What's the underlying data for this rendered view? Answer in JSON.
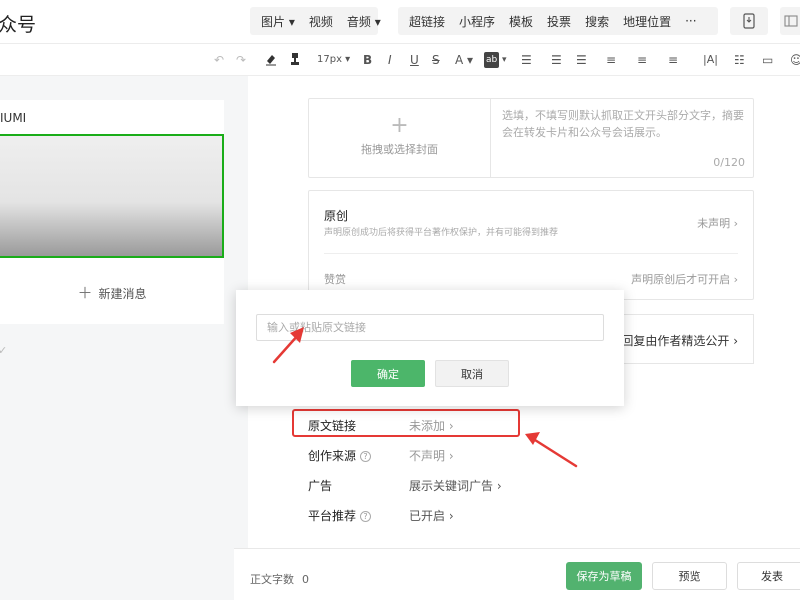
{
  "app": {
    "brand": "众号"
  },
  "top_toolbar": {
    "group1": [
      {
        "label": "图片",
        "dropdown": true
      },
      {
        "label": "视频",
        "dropdown": false
      },
      {
        "label": "音频",
        "dropdown": true
      }
    ],
    "group2": [
      "超链接",
      "小程序",
      "模板",
      "投票",
      "搜索",
      "地理位置",
      "···"
    ]
  },
  "format_toolbar": {
    "font_size": "17px",
    "bold": "B",
    "italic": "I",
    "underline": "U",
    "strike": "S",
    "font_color": "A",
    "bg_color": "ab"
  },
  "left_panel": {
    "title": "IUMI",
    "new_message": "新建消息",
    "check": "✓"
  },
  "cover": {
    "label": "拖拽或选择封面",
    "summary_placeholder": "选填，不填写则默认抓取正文开头部分文字，摘要会在转发卡片和公众号会话展示。",
    "counter": "0/120"
  },
  "original": {
    "title": "原创",
    "description": "声明原创成功后将获得平台著作权保护，并有可能得到推荐",
    "status": "未声明",
    "reward_label": "赞赏",
    "reward_status": "声明原创后才可开启"
  },
  "fragment": {
    "text": "和回复由作者精选公开"
  },
  "settings_rows": [
    {
      "label": "原文链接",
      "value": "未添加",
      "help": false
    },
    {
      "label": "创作来源",
      "value": "不声明",
      "help": true
    },
    {
      "label": "广告",
      "value": "展示关键词广告",
      "help": false
    },
    {
      "label": "平台推荐",
      "value": "已开启",
      "help": true
    }
  ],
  "popup": {
    "input_placeholder": "输入或粘贴原文链接",
    "confirm": "确定",
    "cancel": "取消"
  },
  "bottom_bar": {
    "word_count_label": "正文字数",
    "word_count": "0",
    "save_draft": "保存为草稿",
    "preview": "预览",
    "publish": "发表"
  },
  "colors": {
    "accent_green": "#4cb66a",
    "highlight_red": "#e53935"
  }
}
